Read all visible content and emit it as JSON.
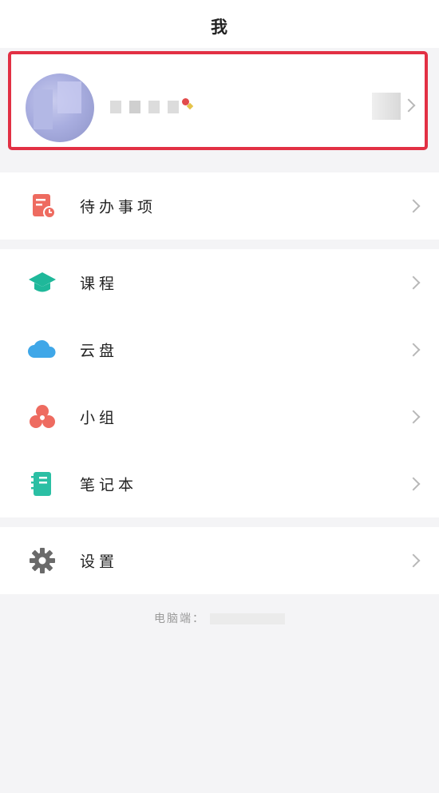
{
  "header": {
    "title": "我"
  },
  "profile": {
    "name": "",
    "icons": {
      "avatar": "avatar-image",
      "chevron": "chevron-right-icon"
    }
  },
  "menu_group_1": [
    {
      "id": "todo",
      "label": "待办事项",
      "icon": "todo-list-icon",
      "color": "#ee6b60"
    }
  ],
  "menu_group_2": [
    {
      "id": "course",
      "label": "课程",
      "icon": "graduation-cap-icon",
      "color": "#1fb89a"
    },
    {
      "id": "cloud",
      "label": "云盘",
      "icon": "cloud-icon",
      "color": "#3fa7e8"
    },
    {
      "id": "group",
      "label": "小组",
      "icon": "group-icon",
      "color": "#ee6b60"
    },
    {
      "id": "notebook",
      "label": "笔记本",
      "icon": "notebook-icon",
      "color": "#2bbfa4"
    }
  ],
  "menu_group_3": [
    {
      "id": "settings",
      "label": "设置",
      "icon": "gear-icon",
      "color": "#6a6a6a"
    }
  ],
  "footer": {
    "label": "电脑端："
  },
  "colors": {
    "highlight_border": "#e23044",
    "background": "#f4f4f6"
  }
}
